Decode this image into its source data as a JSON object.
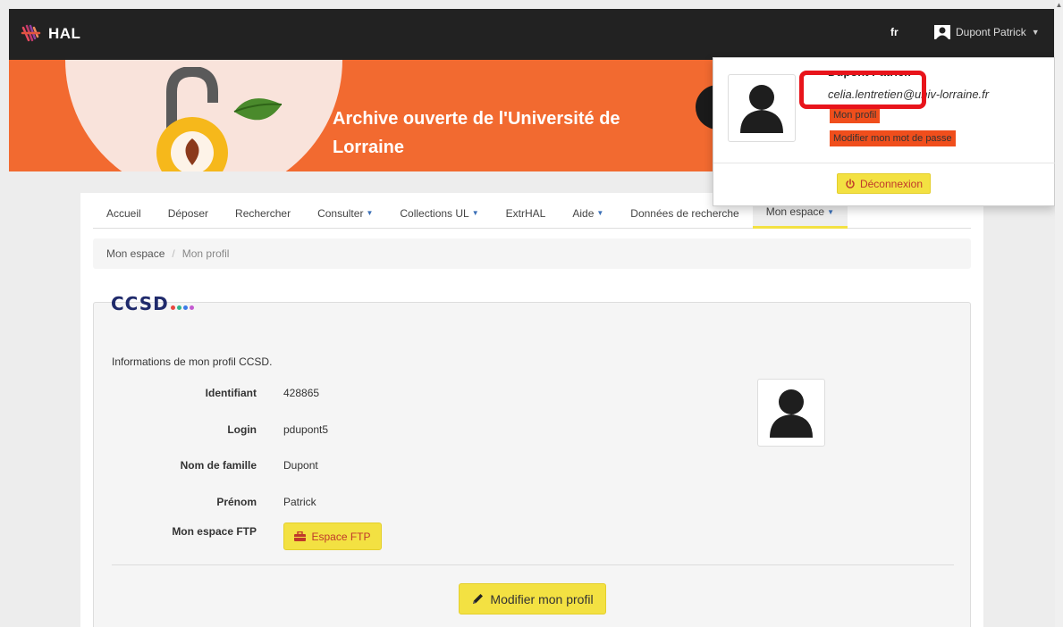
{
  "topbar": {
    "brand": "HAL",
    "language": "fr",
    "user_name": "Dupont Patrick"
  },
  "banner": {
    "title": "Archive ouverte de l'Université de Lorraine"
  },
  "nav": {
    "items": [
      {
        "label": "Accueil",
        "has_dropdown": false
      },
      {
        "label": "Déposer",
        "has_dropdown": false
      },
      {
        "label": "Rechercher",
        "has_dropdown": false
      },
      {
        "label": "Consulter",
        "has_dropdown": true
      },
      {
        "label": "Collections UL",
        "has_dropdown": true
      },
      {
        "label": "ExtrHAL",
        "has_dropdown": false
      },
      {
        "label": "Aide",
        "has_dropdown": true
      },
      {
        "label": "Données de recherche",
        "has_dropdown": false
      },
      {
        "label": "Mon espace",
        "has_dropdown": true
      }
    ],
    "active": "Mon espace"
  },
  "breadcrumb": {
    "parent": "Mon espace",
    "separator": "/",
    "current": "Mon profil"
  },
  "profile": {
    "logo_text": "CCSD",
    "logo_dot_colors": [
      "#e8473f",
      "#2db58c",
      "#3b7be8",
      "#c45ad1"
    ],
    "intro": "Informations de mon profil CCSD.",
    "fields": [
      {
        "label": "Identifiant",
        "value": "428865"
      },
      {
        "label": "Login",
        "value": "pdupont5"
      },
      {
        "label": "Nom de famille",
        "value": "Dupont"
      },
      {
        "label": "Prénom",
        "value": "Patrick"
      },
      {
        "label": "Mon espace FTP",
        "value": ""
      }
    ],
    "ftp_button": "Espace FTP",
    "edit_button": "Modifier mon profil"
  },
  "dropdown": {
    "name": "Dupont Patrick",
    "email": "celia.lentretien@univ-lorraine.fr",
    "profile_link": "Mon profil",
    "password_link": "Modifier mon mot de passe",
    "logout": "Déconnexion"
  },
  "colors": {
    "topbar": "#222222",
    "banner": "#f26a30",
    "accent_yellow": "#f3e142",
    "link_orange": "#f04e1c",
    "highlight_red": "#e8141b"
  }
}
